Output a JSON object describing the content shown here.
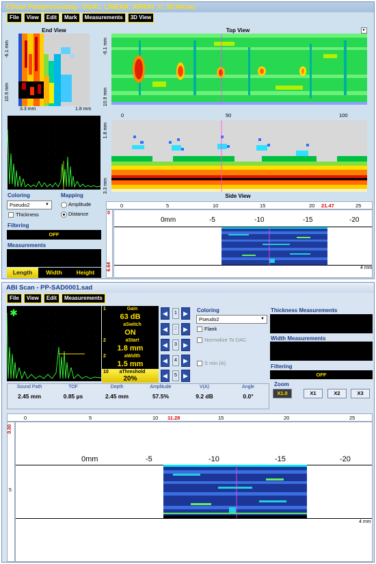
{
  "top_window": {
    "title": "CScan Postprocessing - DUAL_LINEAR_ARRAY_C_SCAN.lac",
    "menu": [
      "File",
      "View",
      "Edit",
      "Mark",
      "Measurements",
      "3D View"
    ],
    "end_view": {
      "title": "End View",
      "y_top": "-6.1 mm",
      "y_bottom": "10.9 mm",
      "x_left": "3.3 mm",
      "x_right": "1.8 mm"
    },
    "top_view": {
      "title": "Top View",
      "y_top": "-6.1 mm",
      "y_bottom": "10.9 mm",
      "ticks": [
        "0",
        "50",
        "100"
      ]
    },
    "side_view": {
      "title": "Side View",
      "y_top": "1.8 mm",
      "y_bottom": "3.3 mm"
    },
    "coloring": {
      "label": "Coloring",
      "selected": "Pseudo2",
      "thickness": "Thickness"
    },
    "mapping": {
      "label": "Mapping",
      "amplitude": "Amplitude",
      "distance": "Distance"
    },
    "filtering": {
      "label": "Filtering",
      "value": "OFF"
    },
    "measurements": {
      "label": "Measurements",
      "buttons": [
        "Length",
        "Width",
        "Height"
      ]
    },
    "bscan": {
      "ruler": [
        "0",
        "5",
        "10",
        "15",
        "20",
        "25"
      ],
      "marker": "21.47",
      "scale": [
        "0mm",
        "-5",
        "-10",
        "-15",
        "-20"
      ],
      "left_top": "0",
      "left_bottom": "6.64",
      "right_unit": "4 mm"
    }
  },
  "bottom_window": {
    "title": "ABI Scan - PP-SAD0001.sad",
    "menu": [
      "File",
      "View",
      "Edit",
      "Measurements"
    ],
    "params": [
      {
        "num": "1",
        "label": "Gain",
        "value": "63 dB"
      },
      {
        "num": "",
        "label": "aSwitch",
        "value": "ON"
      },
      {
        "num": "2",
        "label": "aStart",
        "value": "1.8 mm"
      },
      {
        "num": "2",
        "label": "aWidth",
        "value": "1.5 mm"
      },
      {
        "num": "10",
        "label": "aThreshold",
        "value": "20%"
      }
    ],
    "mini_labels": [
      "1",
      "2",
      "3",
      "4",
      "5"
    ],
    "coloring": {
      "label": "Coloring",
      "selected": "Pseudo2",
      "flank": "Flank",
      "normalize": "Normalize To DAC",
      "smin": "S min (A)"
    },
    "thickness_label": "Thickness Measurements",
    "width_label": "Width Measurements",
    "filtering": {
      "label": "Filtering",
      "value": "OFF"
    },
    "zoom": {
      "label": "Zoom",
      "buttons": [
        "X1.0",
        "X1",
        "X2",
        "X3"
      ]
    },
    "meas_headers": [
      "Sound Path",
      "TOF",
      "Depth",
      "Amplitude",
      "V(A)",
      "Angle"
    ],
    "meas_values": [
      "2.45 mm",
      "0.85 µs",
      "2.45 mm",
      "57.5%",
      "9.2 dB",
      "0.0°"
    ],
    "bscan": {
      "ruler": [
        "0",
        "5",
        "10",
        "15",
        "20",
        "25"
      ],
      "marker": "11.28",
      "scale": [
        "0mm",
        "-5",
        "-10",
        "-15",
        "-20"
      ],
      "left_top": "0.00",
      "left_mid": "5",
      "right_unit": "4 mm"
    }
  }
}
